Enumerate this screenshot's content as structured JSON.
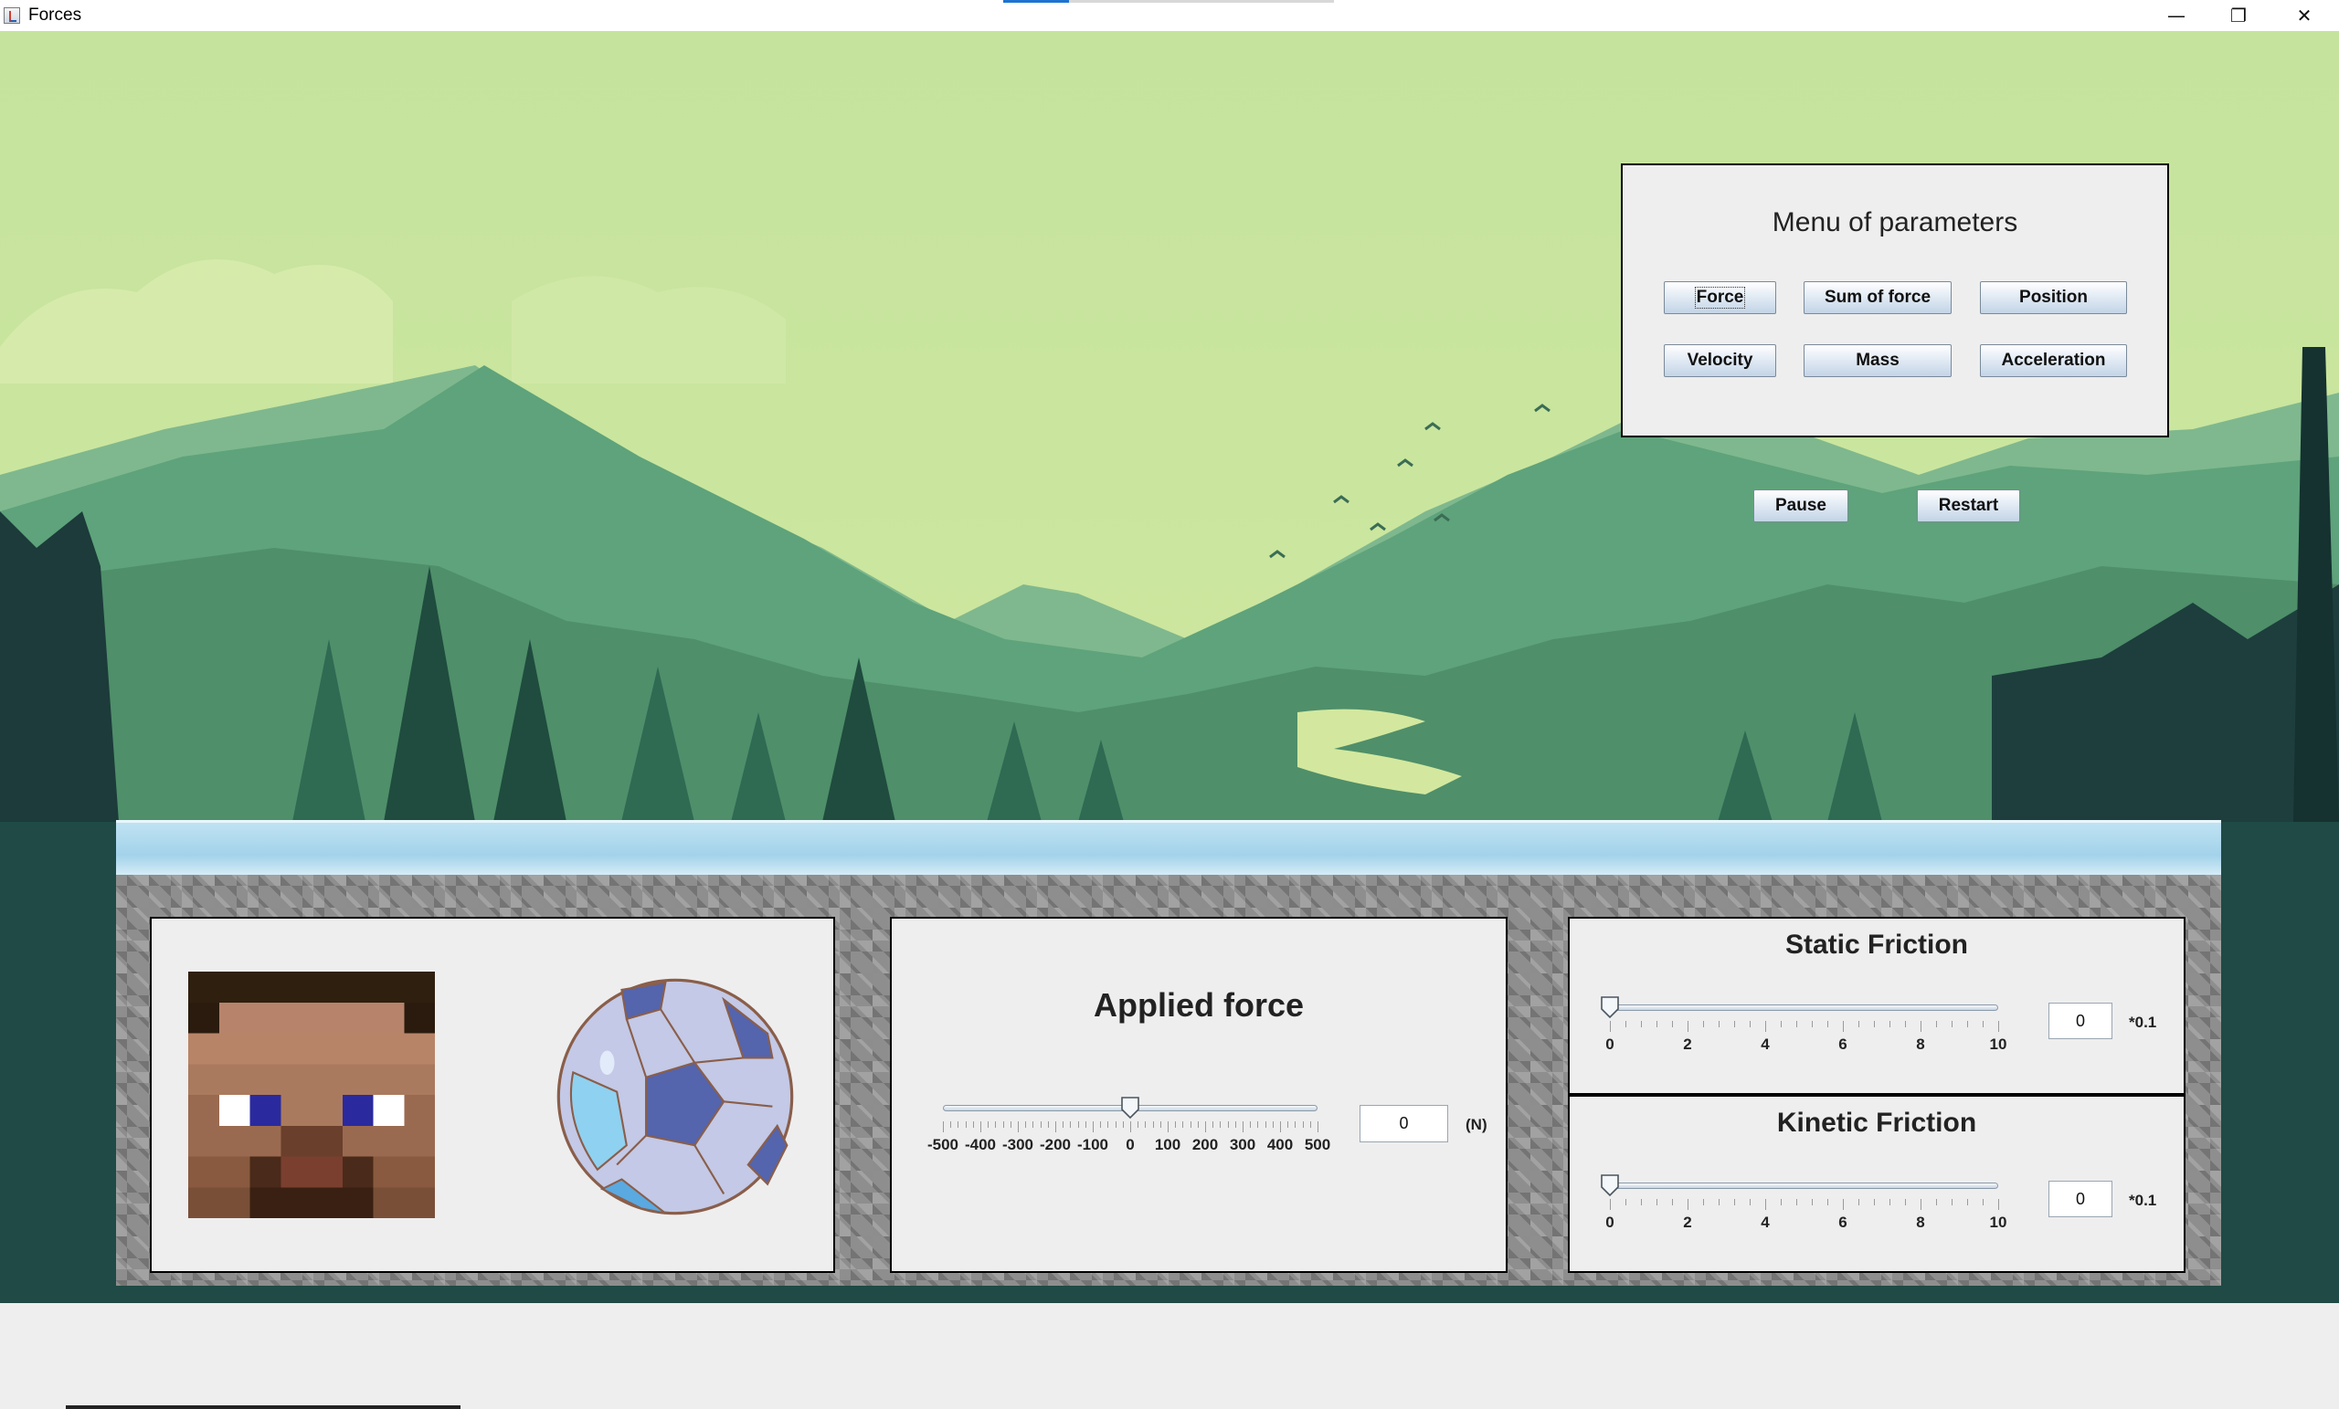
{
  "window": {
    "title": "Forces",
    "controls": {
      "minimize": "—",
      "maximize": "❐",
      "close": "✕"
    }
  },
  "icons": [
    "java-app-icon",
    "minimize-icon",
    "maximize-icon",
    "close-icon",
    "player-head-icon",
    "soccer-ball-icon",
    "slider-thumb-icon"
  ],
  "menu": {
    "title": "Menu of parameters",
    "buttons": {
      "force": "Force",
      "sum_of_force": "Sum of force",
      "position": "Position",
      "velocity": "Velocity",
      "mass": "Mass",
      "acceleration": "Acceleration"
    }
  },
  "controls": {
    "pause": "Pause",
    "restart": "Restart"
  },
  "applied_force": {
    "title": "Applied force",
    "value": "0",
    "unit": "(N)",
    "slider_value": 0,
    "min": -500,
    "max": 500,
    "tick_labels": [
      "-500",
      "-400",
      "-300",
      "-200",
      "-100",
      "0",
      "100",
      "200",
      "300",
      "400",
      "500"
    ]
  },
  "static_friction": {
    "title": "Static Friction",
    "value": "0",
    "unit": "*0.1",
    "slider_value": 0,
    "min": 0,
    "max": 10,
    "tick_labels": [
      "0",
      "2",
      "4",
      "6",
      "8",
      "10"
    ]
  },
  "kinetic_friction": {
    "title": "Kinetic Friction",
    "value": "0",
    "unit": "*0.1",
    "slider_value": 0,
    "min": 0,
    "max": 10,
    "tick_labels": [
      "0",
      "2",
      "4",
      "6",
      "8",
      "10"
    ]
  },
  "colors": {
    "sky": "#c5e39d",
    "panel_bg": "#eeeeee",
    "button_top": "#ffffff",
    "button_bottom": "#c3d4e6",
    "accent": "#1e73d2"
  }
}
